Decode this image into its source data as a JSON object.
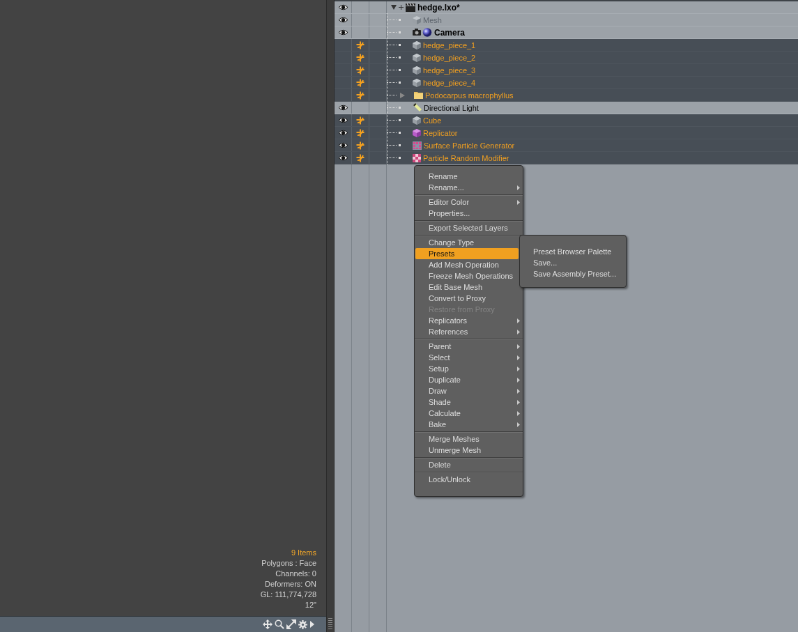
{
  "info_panel": {
    "lines": [
      {
        "text": "9 Items",
        "highlight": true
      },
      {
        "text": "Polygons : Face",
        "highlight": false
      },
      {
        "text": "Channels: 0",
        "highlight": false
      },
      {
        "text": "Deformers: ON",
        "highlight": false
      },
      {
        "text": "GL: 111,774,728",
        "highlight": false
      },
      {
        "text": "12\"",
        "highlight": false
      }
    ]
  },
  "item_list": {
    "items": [
      {
        "label": "hedge.lxo*",
        "kind": "scene",
        "visible": true,
        "marked": false,
        "selected": false,
        "disabled": false,
        "expanded": true,
        "children": [
          {
            "label": "Mesh",
            "kind": "mesh",
            "visible": true,
            "marked": false,
            "selected": false,
            "disabled": true
          },
          {
            "label": "Camera",
            "kind": "camera",
            "visible": true,
            "marked": false,
            "selected": false,
            "disabled": false
          },
          {
            "label": "hedge_piece_1",
            "kind": "mesh",
            "visible": false,
            "marked": true,
            "selected": true,
            "disabled": false
          },
          {
            "label": "hedge_piece_2",
            "kind": "mesh",
            "visible": false,
            "marked": true,
            "selected": true,
            "disabled": false
          },
          {
            "label": "hedge_piece_3",
            "kind": "mesh",
            "visible": false,
            "marked": true,
            "selected": true,
            "disabled": false
          },
          {
            "label": "hedge_piece_4",
            "kind": "mesh",
            "visible": false,
            "marked": true,
            "selected": true,
            "disabled": false
          },
          {
            "label": "Podocarpus macrophyllus",
            "kind": "folder",
            "visible": false,
            "marked": true,
            "selected": true,
            "disabled": false,
            "expanded": false
          },
          {
            "label": "Directional Light",
            "kind": "light",
            "visible": true,
            "marked": false,
            "selected": false,
            "disabled": false
          },
          {
            "label": "Cube",
            "kind": "mesh",
            "visible": true,
            "marked": true,
            "selected": true,
            "disabled": false
          },
          {
            "label": "Replicator",
            "kind": "replicator",
            "visible": true,
            "marked": true,
            "selected": true,
            "disabled": false
          },
          {
            "label": "Surface Particle Generator",
            "kind": "generator",
            "visible": true,
            "marked": true,
            "selected": true,
            "disabled": false
          },
          {
            "label": "Particle Random Modifier",
            "kind": "modifier",
            "visible": true,
            "marked": true,
            "selected": true,
            "disabled": false
          }
        ]
      }
    ]
  },
  "context_menu": {
    "groups": [
      [
        {
          "label": "Rename",
          "submenu": false,
          "disabled": false,
          "selected": false
        },
        {
          "label": "Rename...",
          "submenu": true,
          "disabled": false,
          "selected": false
        }
      ],
      [
        {
          "label": "Editor Color",
          "submenu": true,
          "disabled": false,
          "selected": false
        },
        {
          "label": "Properties...",
          "submenu": false,
          "disabled": false,
          "selected": false
        }
      ],
      [
        {
          "label": "Export Selected Layers",
          "submenu": false,
          "disabled": false,
          "selected": false
        }
      ],
      [
        {
          "label": "Change Type",
          "submenu": false,
          "disabled": false,
          "selected": false
        },
        {
          "label": "Presets",
          "submenu": false,
          "disabled": false,
          "selected": true
        },
        {
          "label": "Add Mesh Operation",
          "submenu": false,
          "disabled": false,
          "selected": false
        },
        {
          "label": "Freeze Mesh Operations",
          "submenu": false,
          "disabled": false,
          "selected": false
        },
        {
          "label": "Edit Base Mesh",
          "submenu": false,
          "disabled": false,
          "selected": false
        },
        {
          "label": "Convert to Proxy",
          "submenu": false,
          "disabled": false,
          "selected": false
        },
        {
          "label": "Restore from Proxy",
          "submenu": false,
          "disabled": true,
          "selected": false
        },
        {
          "label": "Replicators",
          "submenu": true,
          "disabled": false,
          "selected": false
        },
        {
          "label": "References",
          "submenu": true,
          "disabled": false,
          "selected": false
        }
      ],
      [
        {
          "label": "Parent",
          "submenu": true,
          "disabled": false,
          "selected": false
        },
        {
          "label": "Select",
          "submenu": true,
          "disabled": false,
          "selected": false
        },
        {
          "label": "Setup",
          "submenu": true,
          "disabled": false,
          "selected": false
        },
        {
          "label": "Duplicate",
          "submenu": true,
          "disabled": false,
          "selected": false
        },
        {
          "label": "Draw",
          "submenu": true,
          "disabled": false,
          "selected": false
        },
        {
          "label": "Shade",
          "submenu": true,
          "disabled": false,
          "selected": false
        },
        {
          "label": "Calculate",
          "submenu": true,
          "disabled": false,
          "selected": false
        },
        {
          "label": "Bake",
          "submenu": true,
          "disabled": false,
          "selected": false
        }
      ],
      [
        {
          "label": "Merge Meshes",
          "submenu": false,
          "disabled": false,
          "selected": false
        },
        {
          "label": "Unmerge Mesh",
          "submenu": false,
          "disabled": false,
          "selected": false
        }
      ],
      [
        {
          "label": "Delete",
          "submenu": false,
          "disabled": false,
          "selected": false
        }
      ],
      [
        {
          "label": "Lock/Unlock",
          "submenu": false,
          "disabled": false,
          "selected": false
        }
      ]
    ],
    "submenu": {
      "items": [
        {
          "label": "Preset Browser Palette"
        },
        {
          "label": "Save..."
        },
        {
          "label": "Save Assembly Preset..."
        }
      ]
    }
  }
}
